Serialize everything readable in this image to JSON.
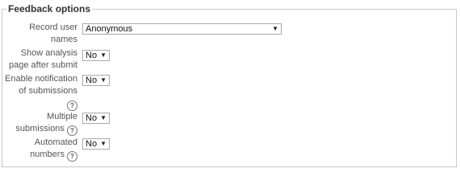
{
  "fieldset": {
    "legend": "Feedback options"
  },
  "fields": {
    "record_user_names": {
      "label_line1": "Record user",
      "label_line2": "names",
      "value": "Anonymous"
    },
    "show_analysis": {
      "label_line1": "Show analysis",
      "label_line2": "page after submit",
      "value": "No"
    },
    "enable_notification": {
      "label_line1": "Enable notification",
      "label_line2": "of submissions",
      "value": "No"
    },
    "multiple_submissions": {
      "label_line1": "Multiple",
      "label_line2": "submissions",
      "value": "No"
    },
    "automated_numbers": {
      "label_line1": "Automated",
      "label_line2": "numbers",
      "value": "No"
    }
  },
  "icons": {
    "help": "?",
    "dropdown": "▼"
  }
}
